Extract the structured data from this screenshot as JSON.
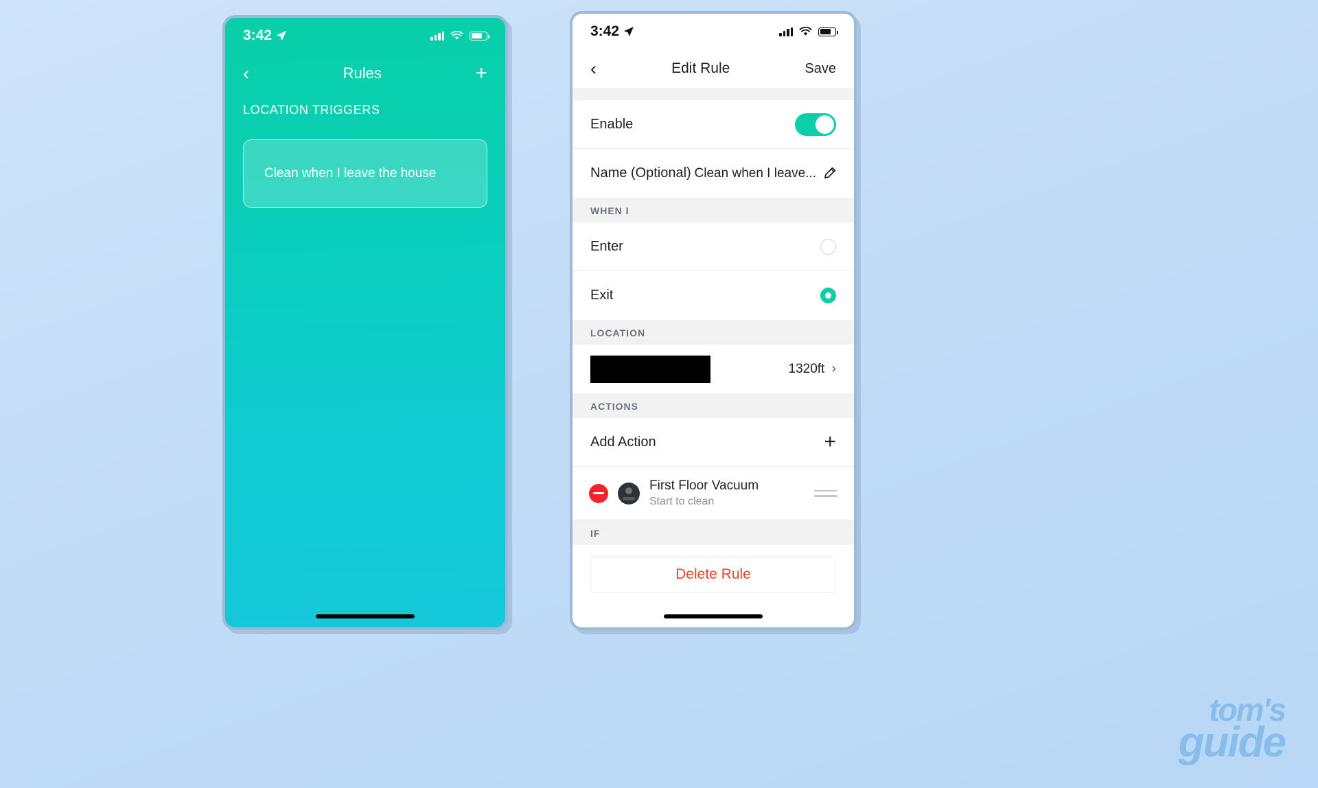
{
  "background": {
    "accent_blue": "#bfdbf7"
  },
  "watermark": {
    "line1": "tom's",
    "line2": "guide",
    "color": "#86bdec"
  },
  "left_phone": {
    "status": {
      "time": "3:42",
      "location_arrow": "location-arrow-icon",
      "signal": "cellular-bars-icon",
      "wifi": "wifi-icon",
      "battery": "battery-icon"
    },
    "nav": {
      "back": "‹",
      "title": "Rules",
      "add": "+"
    },
    "section_caption": "LOCATION TRIGGERS",
    "rules": [
      {
        "title": "Clean when I leave the house"
      }
    ],
    "theme": {
      "gradient_start": "#07cfa8",
      "gradient_end": "#15c8da"
    }
  },
  "right_phone": {
    "status": {
      "time": "3:42",
      "location_arrow": "location-arrow-icon",
      "signal": "cellular-bars-icon",
      "wifi": "wifi-icon",
      "battery": "battery-icon"
    },
    "nav": {
      "back": "‹",
      "title": "Edit Rule",
      "save": "Save"
    },
    "enable": {
      "label": "Enable",
      "state": "on",
      "accent": "#0ccfa9"
    },
    "name": {
      "label": "Name (Optional)",
      "value": "Clean when I leave...",
      "edit_icon": "pencil-icon"
    },
    "when_i": {
      "caption": "WHEN I",
      "options": [
        {
          "label": "Enter",
          "selected": false
        },
        {
          "label": "Exit",
          "selected": true
        }
      ]
    },
    "location": {
      "caption": "LOCATION",
      "address_redacted": true,
      "radius": "1320ft",
      "chevron": "chevron-right-icon"
    },
    "actions": {
      "caption": "ACTIONS",
      "add_label": "Add Action",
      "add_icon": "plus-icon",
      "items": [
        {
          "remove_icon": "minus-circle-icon",
          "device_icon": "robot-vacuum-icon",
          "title": "First Floor Vacuum",
          "subtitle": "Start to clean",
          "drag_icon": "drag-handle-icon"
        }
      ]
    },
    "if_section": {
      "caption": "IF"
    },
    "delete": {
      "label": "Delete Rule",
      "color": "#f04124"
    }
  }
}
